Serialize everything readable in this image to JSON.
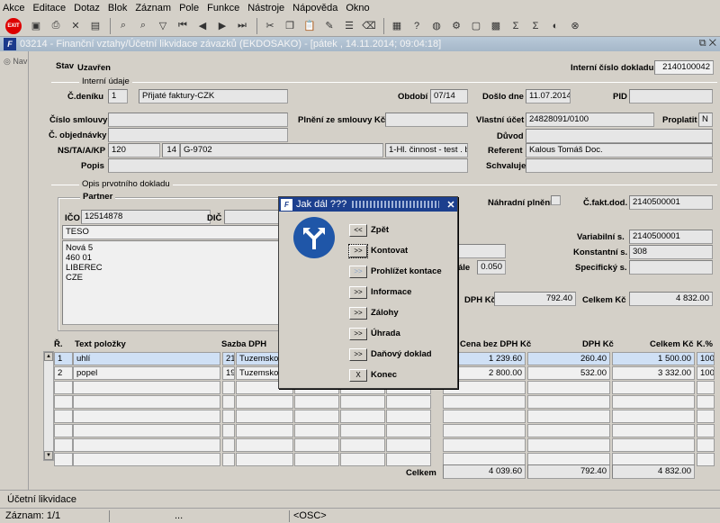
{
  "menu": [
    "Akce",
    "Editace",
    "Dotaz",
    "Blok",
    "Záznam",
    "Pole",
    "Funkce",
    "Nástroje",
    "Nápověda",
    "Okno"
  ],
  "window_title": "03214 - Finanční vztahy/Účetní likvidace závazků (EKDOSAKO) - [pátek , 14.11.2014; 09:04:18]",
  "nav_label": "Nav",
  "header": {
    "stav_label": "Stav",
    "stav_value": "Uzavřen",
    "icd_label": "Interní číslo dokladu",
    "icd_value": "2140100042"
  },
  "interni": {
    "section": "Interní údaje",
    "cdeniku_label": "Č.deníku",
    "cdeniku_value": "1",
    "cdeniku_text": "Přijaté faktury-CZK",
    "obdobi_label": "Období",
    "obdobi_value": "07/14",
    "doslo_label": "Došlo dne",
    "doslo_value": "11.07.2014",
    "pid_label": "PID",
    "pid_value": "",
    "smlouvy_label": "Číslo smlouvy",
    "smlouvy_value": "",
    "plneni_label": "Plnění ze smlouvy Kč",
    "plneni_value": "",
    "vlastni_label": "Vlastní účet",
    "vlastni_value": "24828091/0100",
    "proplatit_label": "Proplatit",
    "proplatit_value": "N",
    "objednavky_label": "Č. objednávky",
    "objednavky_value": "",
    "duvod_label": "Důvod",
    "duvod_value": "",
    "ns_label": "NS/TA/A/KP",
    "ns_value": "120",
    "ta_value": "14",
    "a_value": "G-9702",
    "kp_value": "1-Hl. činnost - test . bbb",
    "referent_label": "Referent",
    "referent_value": "Kalous Tomáš Doc.",
    "popis_label": "Popis",
    "popis_value": "",
    "schvaluje_label": "Schvaluje",
    "schvaluje_value": ""
  },
  "prvotni": {
    "section": "Opis prvotního dokladu",
    "partner_label": "Partner",
    "ico_label": "IČO",
    "ico_value": "12514878",
    "dic_label": "DIČ",
    "dic_value": "",
    "name": "TESO",
    "address": [
      "Nová 5",
      "460 01",
      "LIBEREC",
      "CZE"
    ],
    "nahradni_label": "Náhradní plnění",
    "cfakt_label": "Č.fakt.dod.",
    "cfakt_value": "2140500001",
    "vs_label": "Variabilní s.",
    "vs_value": "2140500001",
    "ks_label": "Konstantní s.",
    "ks_value": "308",
    "ss_label": "Specifický s.",
    "ss_value": "",
    "kurz_label": "ále",
    "kurz_value": "0.050",
    "dph_label": "DPH Kč",
    "dph_value": "792.40",
    "celkem_label": "Celkem Kč",
    "celkem_value": "4 832.00"
  },
  "items": {
    "headers": {
      "r": "Ř.",
      "text": "Text položky",
      "sazba": "Sazba DPH",
      "cena": "Cena bez DPH Kč",
      "dph": "DPH Kč",
      "celkem": "Celkem Kč",
      "k": "K.%"
    },
    "rows": [
      {
        "r": "1",
        "text": "uhlí",
        "sazba": "21",
        "sazba_text": "Tuzemsko 2",
        "cena": "1 239.60",
        "dph": "260.40",
        "celkem": "1 500.00",
        "k": "100"
      },
      {
        "r": "2",
        "text": "popel",
        "sazba": "19",
        "sazba_text": "Tuzemsko",
        "cena": "2 800.00",
        "dph": "532.00",
        "celkem": "3 332.00",
        "k": "100"
      }
    ],
    "total_label": "Celkem",
    "total_cena": "4 039.60",
    "total_dph": "792.40",
    "total_celkem": "4 832.00"
  },
  "dialog": {
    "title": "Jak dál ???",
    "options": [
      {
        "btn": "<<",
        "label": "Zpět"
      },
      {
        "btn": ">>",
        "label": "Kontovat"
      },
      {
        "btn": ">>",
        "label": "Prohlížet kontace"
      },
      {
        "btn": ">>",
        "label": "Informace"
      },
      {
        "btn": ">>",
        "label": "Zálohy"
      },
      {
        "btn": ">>",
        "label": "Úhrada"
      },
      {
        "btn": ">>",
        "label": "Daňový doklad"
      },
      {
        "btn": "X",
        "label": "Konec"
      }
    ]
  },
  "status": {
    "form": "Účetní likvidace",
    "record": "Záznam: 1/1",
    "dots": "...",
    "osc": "<OSC>"
  },
  "colors": {
    "dialog_title": "#1c3f8e",
    "selected_row": "#cfe0f5",
    "sign": "#1f56a8"
  }
}
